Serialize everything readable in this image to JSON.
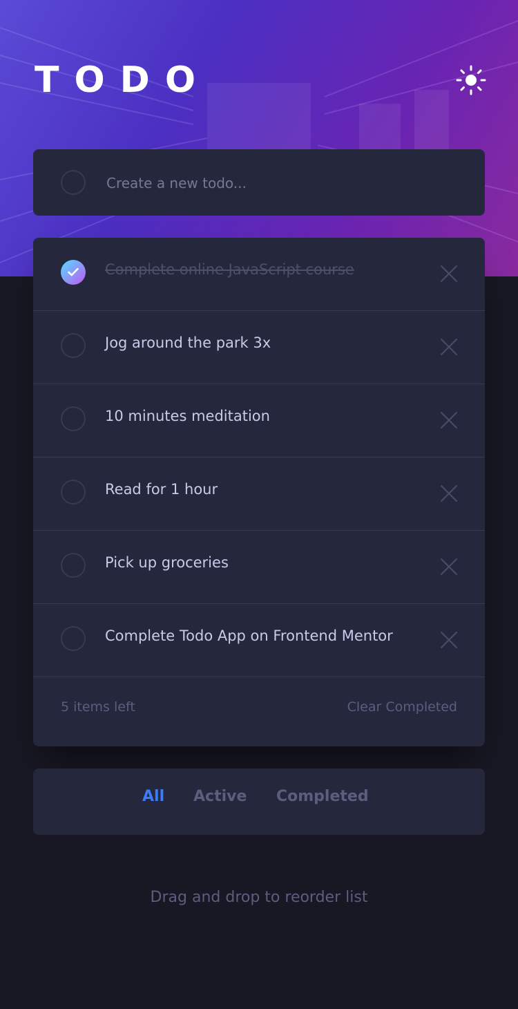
{
  "app": {
    "title": "TODO"
  },
  "header": {
    "theme_icon": "sun-icon"
  },
  "new_todo": {
    "placeholder": "Create a new todo..."
  },
  "todos": [
    {
      "text": "Complete online JavaScript course",
      "completed": true
    },
    {
      "text": "Jog around the park 3x",
      "completed": false
    },
    {
      "text": "10 minutes meditation",
      "completed": false
    },
    {
      "text": "Read for 1 hour",
      "completed": false
    },
    {
      "text": "Pick up groceries",
      "completed": false
    },
    {
      "text": "Complete Todo App on Frontend Mentor",
      "completed": false
    }
  ],
  "footer": {
    "items_left": "5 items left",
    "clear_label": "Clear Completed"
  },
  "filters": {
    "all": "All",
    "active": "Active",
    "completed": "Completed",
    "selected": "All"
  },
  "hint": "Drag and drop to reorder list",
  "colors": {
    "accent": "#3a7cfd",
    "card": "#25273d",
    "background": "#171823",
    "check_gradient_start": "#55ddff",
    "check_gradient_end": "#c058f3"
  }
}
